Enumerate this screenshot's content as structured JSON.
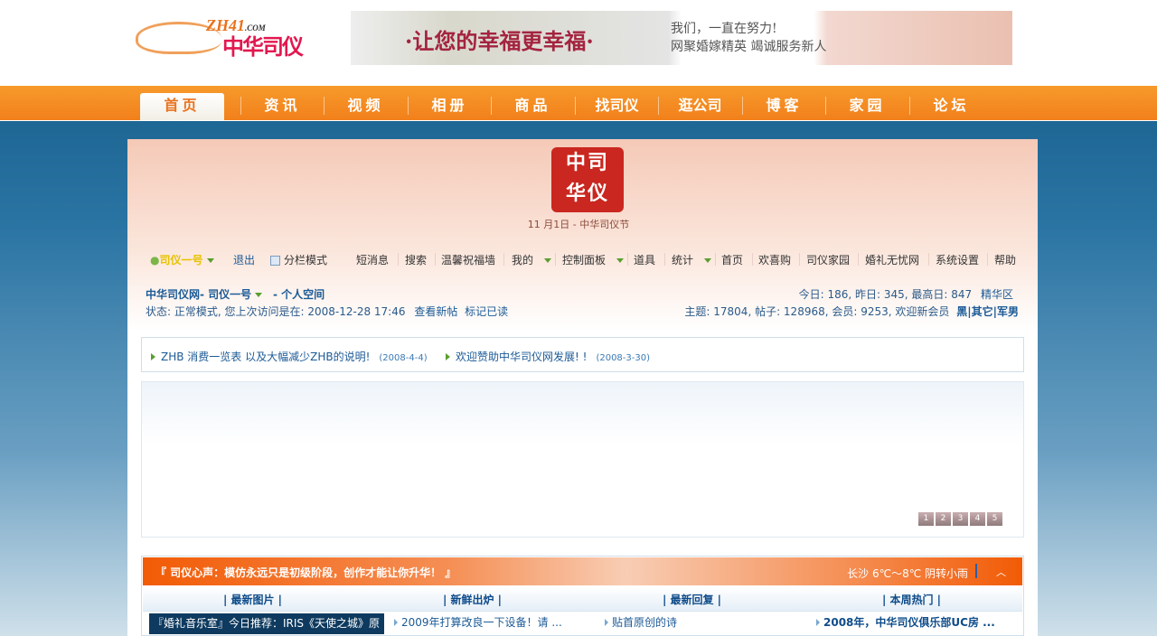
{
  "header": {
    "logo_text": "ZH41.COM 中华司仪",
    "banner_slogan": "·让您的幸福更幸福·",
    "banner_sub1": "我们，一直在努力!",
    "banner_sub2": "网聚婚嫁精英 竭诚服务新人"
  },
  "nav": [
    "首页",
    "资讯",
    "视频",
    "相册",
    "商品",
    "找司仪",
    "逛公司",
    "博客",
    "家园",
    "论坛"
  ],
  "seal_text": "中司华仪",
  "festival": "11 月1日 - 中华司仪节",
  "toolbar": {
    "user": "司仪一号",
    "logout": "退出",
    "split_mode": "分栏模式",
    "items": [
      "短消息",
      "搜索",
      "温馨祝福墙",
      "我的",
      "控制面板",
      "道具",
      "统计",
      "首页",
      "欢喜购",
      "司仪家园",
      "婚礼无忧网",
      "系统设置",
      "帮助"
    ]
  },
  "info": {
    "breadcrumb_site": "中华司仪网- 司仪一号",
    "personal_space": "- 个人空间",
    "status": "状态: 正常模式, 您上次访问是在: 2008-12-28 17:46",
    "view_new": "查看新帖",
    "mark_read": "标记已读",
    "today_stats": "今日: 186, 昨日: 345, 最高日: 847",
    "digest": "精华区",
    "totals": "主题: 17804, 帖子: 128968, 会员: 9253, 欢迎新会员",
    "new_member": "黑|其它|军男"
  },
  "announcements": [
    {
      "title": "ZHB 消费一览表  以及大幅减少ZHB的说明!",
      "date": "(2008-4-4)"
    },
    {
      "title": "欢迎赞助中华司仪网发展! !",
      "date": "(2008-3-30)"
    }
  ],
  "slide_pages": [
    "1",
    "2",
    "3",
    "4",
    "5"
  ],
  "bottom": {
    "motto": "『 司仪心声：模仿永远只是初级阶段，创作才能让你升华！ 』",
    "weather": "长沙  6℃～8℃ 阴转小雨",
    "up": "︿",
    "tabs": [
      "| 最新图片 |",
      "| 新鲜出炉 |",
      "| 最新回复 |",
      "| 本周热门 |"
    ],
    "music": "『婚礼音乐室』今日推荐：IRIS《天使之城》原",
    "cells": [
      "2009年打算改良一下设备！请 ...",
      "贴首原创的诗",
      "2008年，中华司仪俱乐部UC房 ..."
    ]
  }
}
